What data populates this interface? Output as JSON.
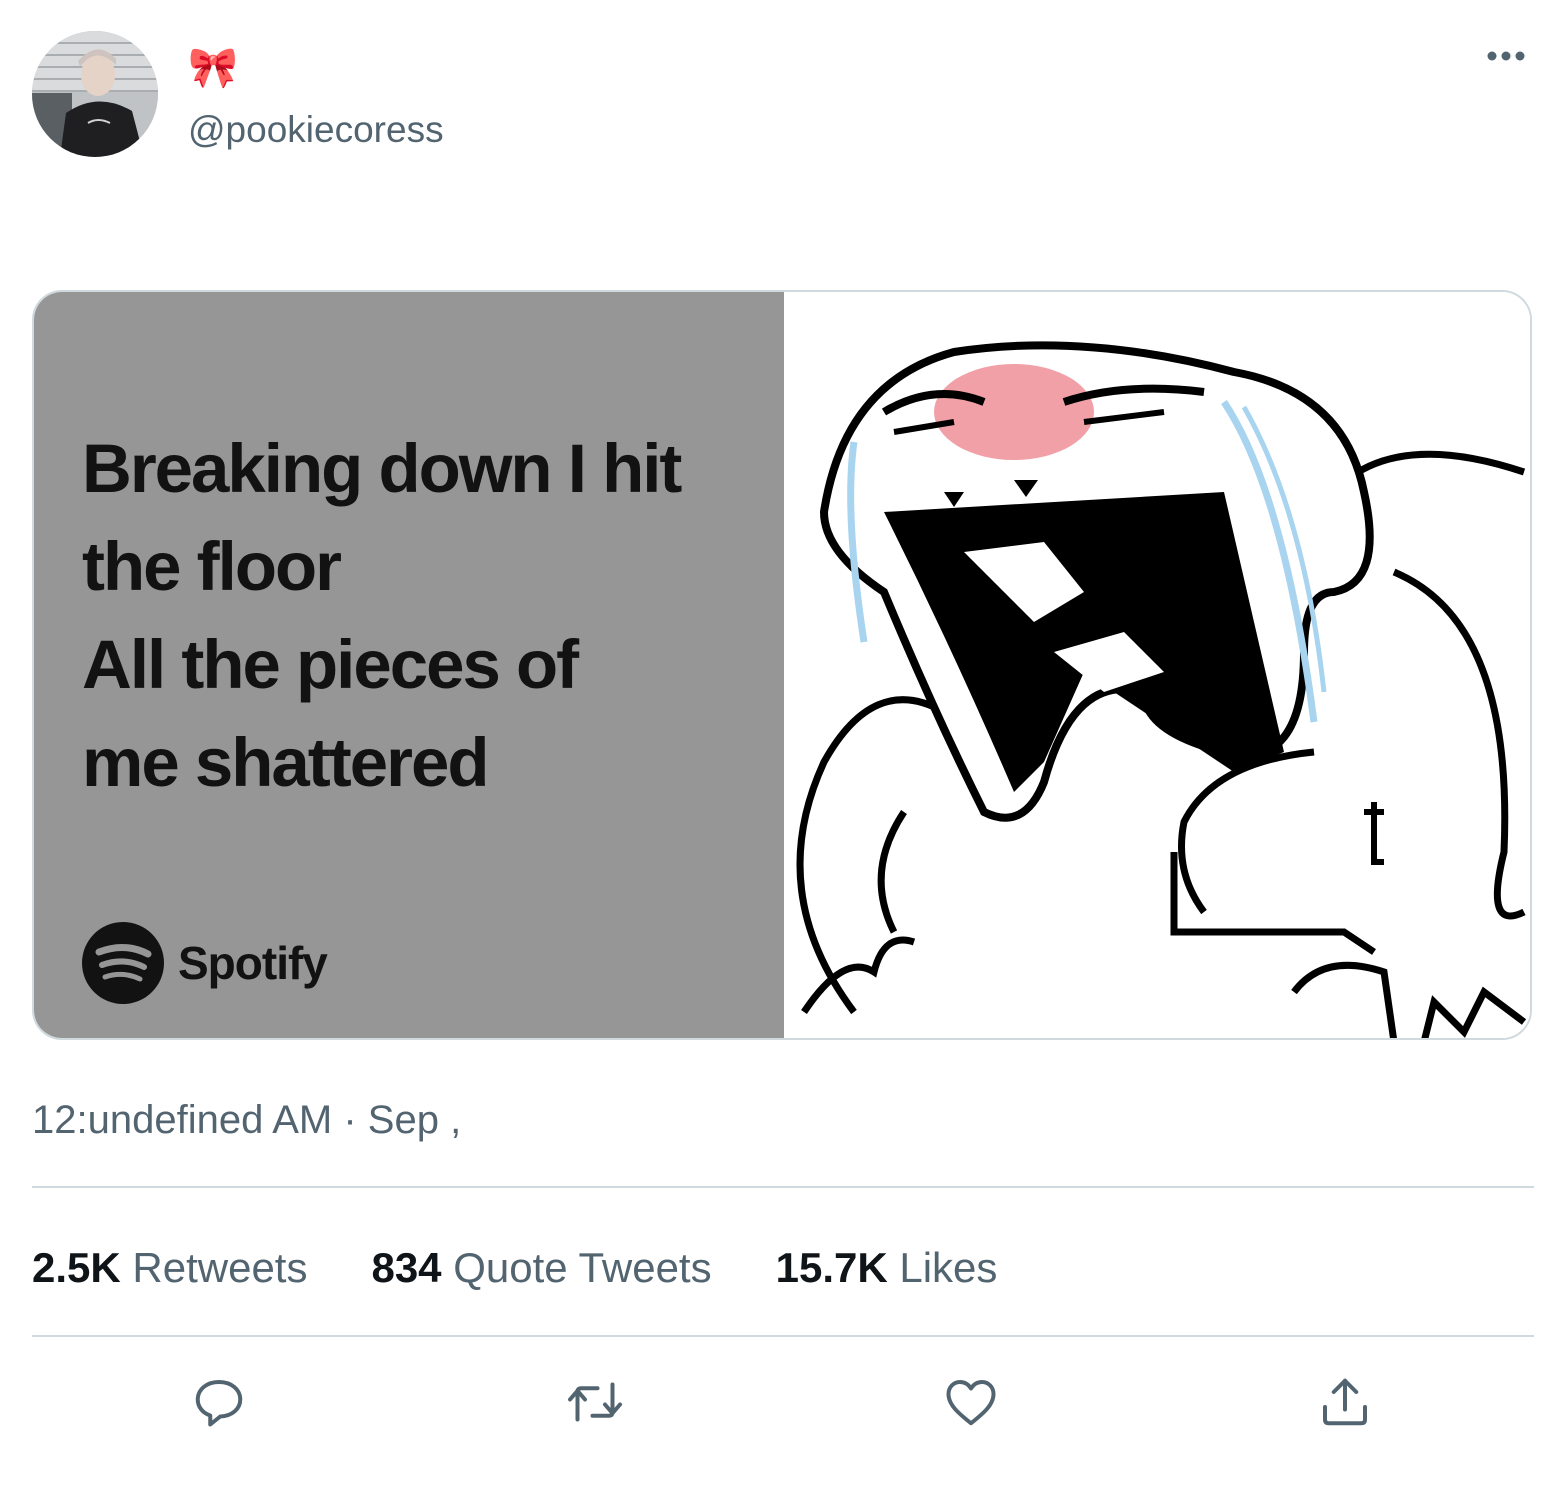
{
  "tweet": {
    "author": {
      "display_name": "🎀",
      "handle": "@pookiecoress"
    },
    "media": {
      "lyrics_lines": [
        "Breaking down I hit",
        "the floor",
        "All the pieces of",
        "me shattered"
      ],
      "brand": "Spotify",
      "lyrics_card_color": "#969696"
    },
    "timestamp": "12:undefined AM · Sep ,",
    "stats": [
      {
        "count": "2.5K",
        "label": "Retweets"
      },
      {
        "count": "834",
        "label": "Quote Tweets"
      },
      {
        "count": "15.7K",
        "label": "Likes"
      }
    ],
    "actions": [
      "reply-icon",
      "retweet-icon",
      "like-icon",
      "share-icon"
    ],
    "more_icon": "more-horizontal-icon"
  }
}
